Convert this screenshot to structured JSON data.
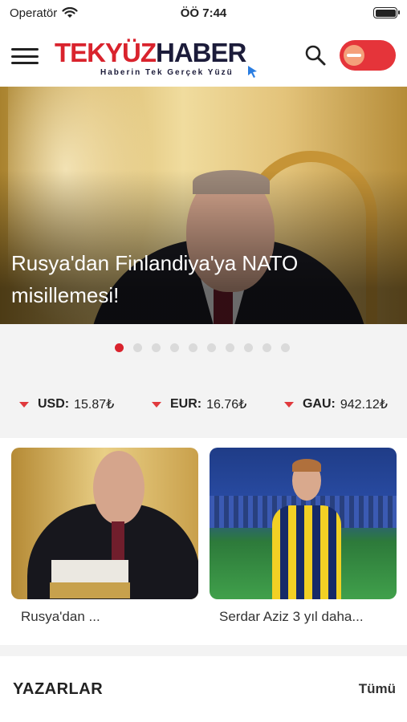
{
  "status_bar": {
    "carrier": "Operatör",
    "time": "ÖÖ 7:44"
  },
  "header": {
    "logo_part1": "TEKYÜZ",
    "logo_part2": "HABER",
    "tagline": "Haberin Tek Gerçek Yüzü"
  },
  "hero": {
    "title": "Rusya'dan Finlandiya'ya NATO misillemesi!",
    "page_count": 10,
    "active_page": 0
  },
  "rates": [
    {
      "code": "USD:",
      "value": "15.87₺",
      "trend": "down"
    },
    {
      "code": "EUR:",
      "value": "16.76₺",
      "trend": "down"
    },
    {
      "code": "GAU:",
      "value": "942.12₺",
      "trend": "down"
    }
  ],
  "cards": [
    {
      "caption": "Rusya'dan ..."
    },
    {
      "caption": "Serdar Aziz 3 yıl daha..."
    }
  ],
  "writers": {
    "title": "YAZARLAR",
    "all_label": "Tümü"
  },
  "colors": {
    "brand_red": "#d9232d",
    "brand_dark": "#1c1c3a",
    "toggle_bg": "#e5343a",
    "trend_down": "#e0393d"
  }
}
